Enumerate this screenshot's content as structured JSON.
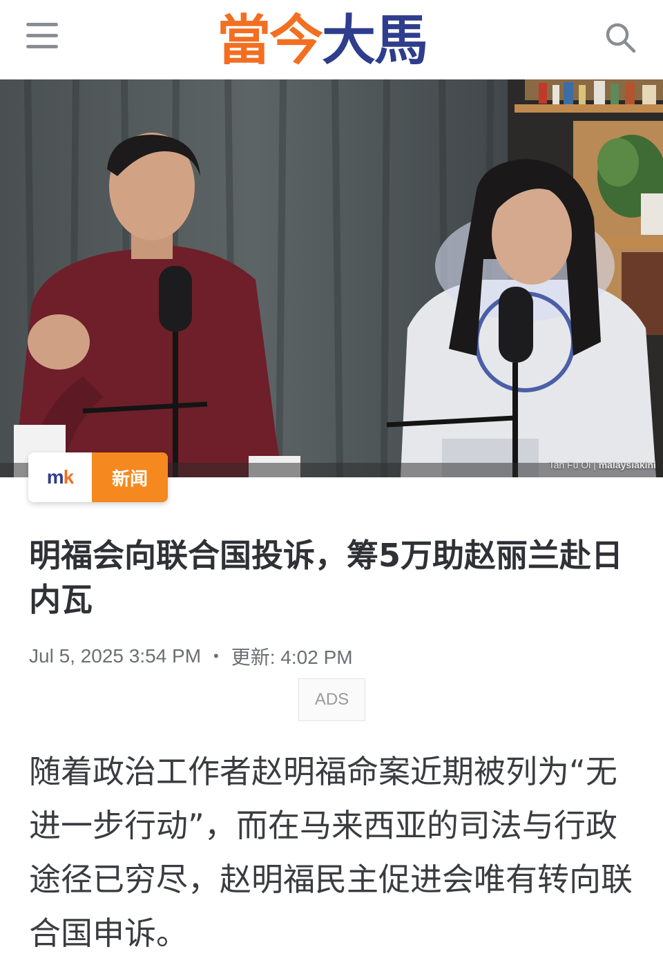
{
  "header": {
    "menu_icon": "hamburger-menu-icon",
    "logo_part1": "當今",
    "logo_part2": "大馬",
    "search_icon": "search-icon"
  },
  "hero": {
    "photo_credit_name": "Tan Fu Oi",
    "photo_credit_separator": "|",
    "photo_credit_source": "malaysiakini"
  },
  "badge": {
    "logo_m": "m",
    "logo_k": "k",
    "category": "新闻",
    "category_color": "#f5891f"
  },
  "article": {
    "title": "明福会向联合国投诉，筹5万助赵丽兰赴日内瓦",
    "published": "Jul 5, 2025 3:54 PM",
    "separator": "•",
    "updated": "更新: 4:02 PM",
    "ads_label": "ADS",
    "lead": "随着政治工作者赵明福命案近期被列为“无进一步行动”，而在马来西亚的司法与行政途径已穷尽，赵明福民主促进会唯有转向联合国申诉。"
  },
  "colors": {
    "brand_orange": "#f26f21",
    "brand_navy": "#2e3d8c"
  }
}
